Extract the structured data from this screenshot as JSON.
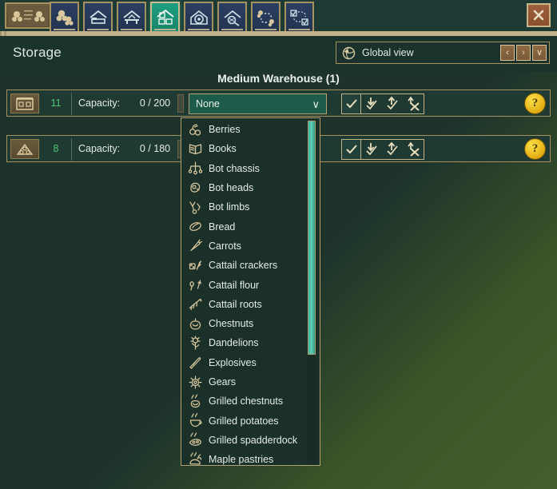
{
  "window": {
    "close_label": "✕"
  },
  "toolbar": {
    "logo_name": "colony-logo",
    "buttons": [
      {
        "name": "tab-population",
        "icon": "population-icon",
        "active": false
      },
      {
        "name": "tab-housing",
        "icon": "bed-house-icon",
        "active": false
      },
      {
        "name": "tab-production",
        "icon": "workshop-house-icon",
        "active": false
      },
      {
        "name": "tab-storage",
        "icon": "storage-house-icon",
        "active": true
      },
      {
        "name": "tab-mechanical",
        "icon": "gear-house-icon",
        "active": false
      },
      {
        "name": "tab-research",
        "icon": "science-house-icon",
        "active": false
      },
      {
        "name": "tab-logistics",
        "icon": "hauling-route-icon",
        "active": false
      },
      {
        "name": "tab-orders",
        "icon": "checklist-route-icon",
        "active": false
      }
    ]
  },
  "header": {
    "title": "Storage",
    "view_selector": {
      "icon": "globe-icon",
      "label": "Global view",
      "prev_label": "‹",
      "next_label": "›",
      "expand_label": "∨"
    }
  },
  "storage": {
    "group_title": "Medium Warehouse (1)",
    "rows": [
      {
        "icon": "crate-icon",
        "count": "11",
        "capacity_label": "Capacity:",
        "capacity_value": "0 / 200",
        "filter_value": "None",
        "chevron": "∨",
        "toggle_check": "✓",
        "accept_in": "accept-incoming-icon",
        "accept_out": "accept-outgoing-icon",
        "forbid": "forbid-icon",
        "help_label": "?"
      },
      {
        "icon": "stockpile-icon",
        "count": "8",
        "capacity_label": "Capacity:",
        "capacity_value": "0 / 180",
        "filter_value": "",
        "chevron": "∨",
        "toggle_check": "✓",
        "accept_in": "accept-incoming-icon",
        "accept_out": "accept-outgoing-icon",
        "forbid": "forbid-icon",
        "help_label": "?"
      }
    ]
  },
  "dropdown": {
    "open": true,
    "selected": "None",
    "items": [
      {
        "label": "Berries",
        "icon": "berries-icon"
      },
      {
        "label": "Books",
        "icon": "book-icon"
      },
      {
        "label": "Bot chassis",
        "icon": "bot-chassis-icon"
      },
      {
        "label": "Bot heads",
        "icon": "bot-head-icon"
      },
      {
        "label": "Bot limbs",
        "icon": "bot-limb-icon"
      },
      {
        "label": "Bread",
        "icon": "bread-icon"
      },
      {
        "label": "Carrots",
        "icon": "carrot-icon"
      },
      {
        "label": "Cattail crackers",
        "icon": "crackers-icon"
      },
      {
        "label": "Cattail flour",
        "icon": "flour-icon"
      },
      {
        "label": "Cattail roots",
        "icon": "roots-icon"
      },
      {
        "label": "Chestnuts",
        "icon": "chestnut-icon"
      },
      {
        "label": "Dandelions",
        "icon": "dandelion-icon"
      },
      {
        "label": "Explosives",
        "icon": "explosives-icon"
      },
      {
        "label": "Gears",
        "icon": "gear-icon"
      },
      {
        "label": "Grilled chestnuts",
        "icon": "grilled-chestnuts-icon"
      },
      {
        "label": "Grilled potatoes",
        "icon": "grilled-potatoes-icon"
      },
      {
        "label": "Grilled spadderdock",
        "icon": "grilled-spadderdock-icon"
      },
      {
        "label": "Maple pastries",
        "icon": "maple-pastries-icon"
      }
    ]
  },
  "colors": {
    "panel_bg": "#1b332d",
    "border_tan": "#a5925f",
    "accent_green": "#4fc878",
    "select_bg": "#1d5b4b",
    "scroll_thumb": "#5fd0b6",
    "help_yellow": "#e0ac12"
  }
}
